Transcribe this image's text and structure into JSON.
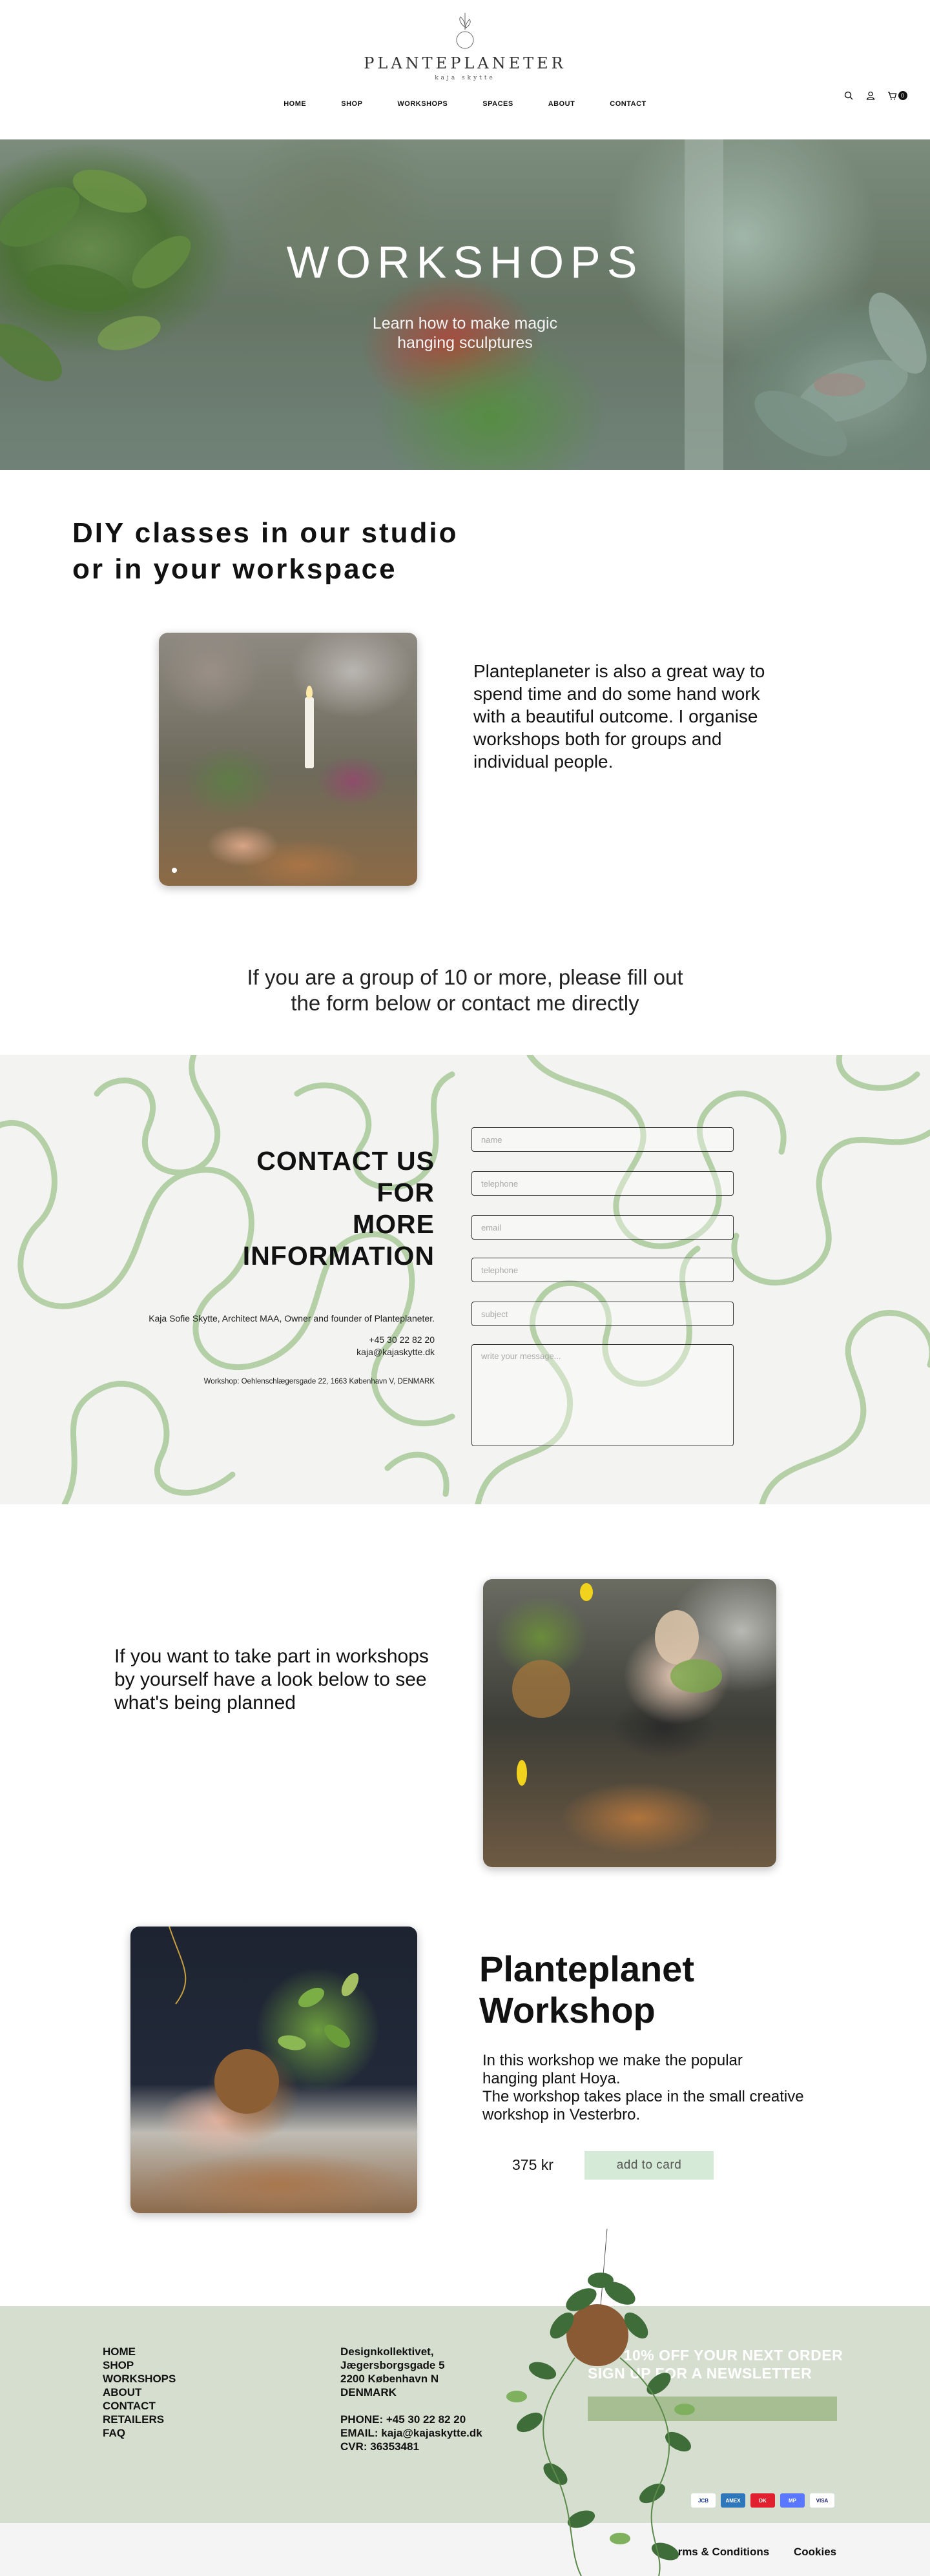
{
  "brand": {
    "name": "PLANTEPLANETER",
    "sub": "kaja skytte"
  },
  "nav": [
    {
      "label": "HOME"
    },
    {
      "label": "SHOP"
    },
    {
      "label": "WORKSHOPS"
    },
    {
      "label": "SPACES"
    },
    {
      "label": "ABOUT"
    },
    {
      "label": "CONTACT"
    }
  ],
  "header_icons": {
    "search": "search-icon",
    "account": "user-icon",
    "cart": "cart-icon",
    "cart_count": "0"
  },
  "hero": {
    "title": "WORKSHOPS",
    "subtitle_line1": "Learn how to make magic",
    "subtitle_line2": "hanging sculptures"
  },
  "intro": {
    "heading_line1": "DIY classes in our studio",
    "heading_line2": "or in your workspace",
    "text": "Planteplaneter is also a great way to spend time and do some hand work with a beautiful outcome. I organise workshops both for groups and individual people."
  },
  "group_text": {
    "line1": "If you are a group of 10 or more, please fill out",
    "line2": "the form below or contact me directly"
  },
  "contact": {
    "heading_line1": "CONTACT US",
    "heading_line2": "FOR",
    "heading_line3": "MORE",
    "heading_line4": "INFORMATION",
    "owner": "Kaja Sofie Skytte, Architect MAA, Owner and founder of Planteplaneter.",
    "phone": "+45 30 22 82 20",
    "email": "kaja@kajaskytte.dk",
    "address": "Workshop: Oehlenschlægersgade 22, 1663 København V, DENMARK",
    "fields": {
      "name": "name",
      "telephone": "telephone",
      "email": "email",
      "telephone2": "telephone",
      "subject": "subject",
      "message": "write your message..."
    }
  },
  "planned_text": "If you want to take part in workshops by yourself have a look below to see what's being planned",
  "product": {
    "title_line1": "Planteplanet",
    "title_line2": "Workshop",
    "desc_line1": "In this workshop we make the popular",
    "desc_line2": "hanging plant Hoya.",
    "desc_line3": "The workshop takes place in the small creative",
    "desc_line4": "workshop in Vesterbro.",
    "price": "375 kr",
    "button": "add to card"
  },
  "footer": {
    "links": [
      {
        "label": "HOME"
      },
      {
        "label": "SHOP"
      },
      {
        "label": "WORKSHOPS"
      },
      {
        "label": "ABOUT"
      },
      {
        "label": "CONTACT"
      },
      {
        "label": "RETAILERS"
      },
      {
        "label": "FAQ"
      }
    ],
    "address": {
      "line1": "Designkollektivet,",
      "line2": "Jægersborgsgade 5",
      "line3": "2200 København N",
      "line4": "DENMARK",
      "phone": "PHONE: +45 30 22 82 20",
      "email": "EMAIL: kaja@kajaskytte.dk",
      "cvr": "CVR: 36353481"
    },
    "newsletter_line1": "GET 10% OFF YOUR NEXT ORDER",
    "newsletter_line2": "SIGN UP FOR A NEWSLETTER",
    "payments": [
      {
        "name": "jcb-icon",
        "label": "JCB",
        "color": "#ffffff"
      },
      {
        "name": "amex-icon",
        "label": "AMEX",
        "color": "#2e77bb"
      },
      {
        "name": "dankort-icon",
        "label": "DK",
        "color": "#e0202e"
      },
      {
        "name": "mobilepay-icon",
        "label": "MP",
        "color": "#5a78ff"
      },
      {
        "name": "visa-icon",
        "label": "VISA",
        "color": "#ffffff"
      }
    ],
    "terms": "Terms & Conditions",
    "cookies": "Cookies"
  },
  "colors": {
    "accent_green": "#d6ead8",
    "footer_bg": "#d6dfcf",
    "newsletter_input": "#a7be92",
    "squiggle": "#9fc38f"
  }
}
